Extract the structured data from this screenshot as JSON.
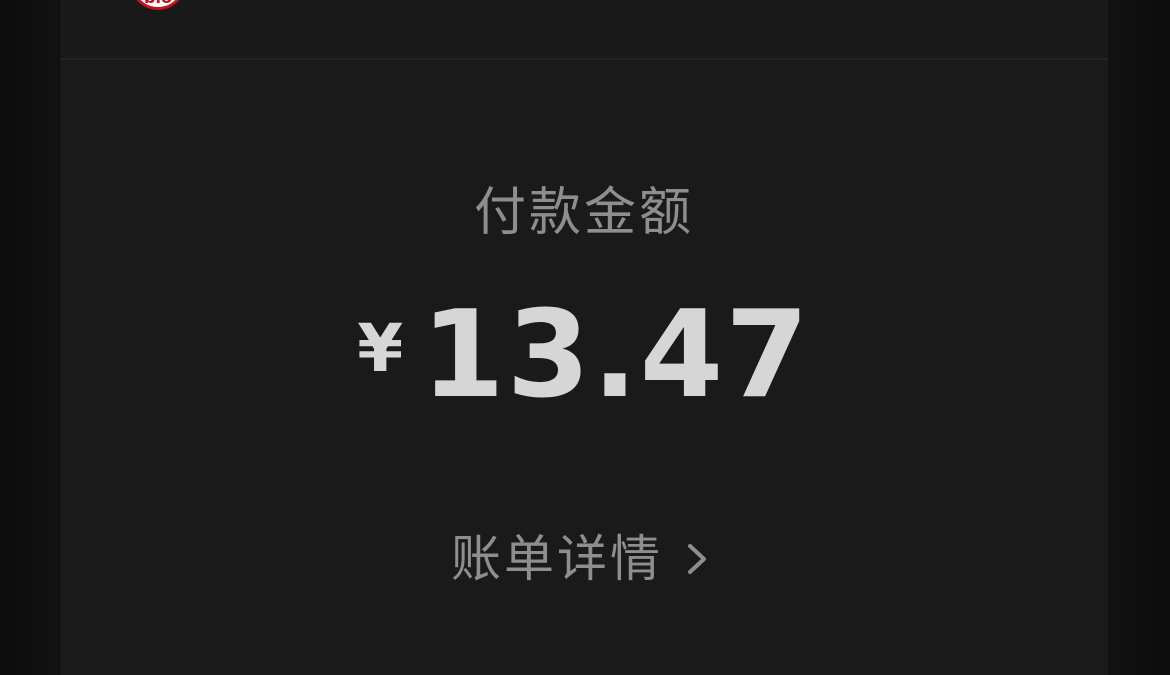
{
  "header": {
    "logo_text": "bio"
  },
  "payment": {
    "label": "付款金额",
    "currency_symbol": "¥",
    "amount": "13.47"
  },
  "bill_details": {
    "label": "账单详情",
    "icon": "chevron-right-icon"
  },
  "colors": {
    "background": "#1a1a1a",
    "label_text": "#8e8e8e",
    "amount_text": "#d6d6d6",
    "logo_red": "#c8101c"
  }
}
